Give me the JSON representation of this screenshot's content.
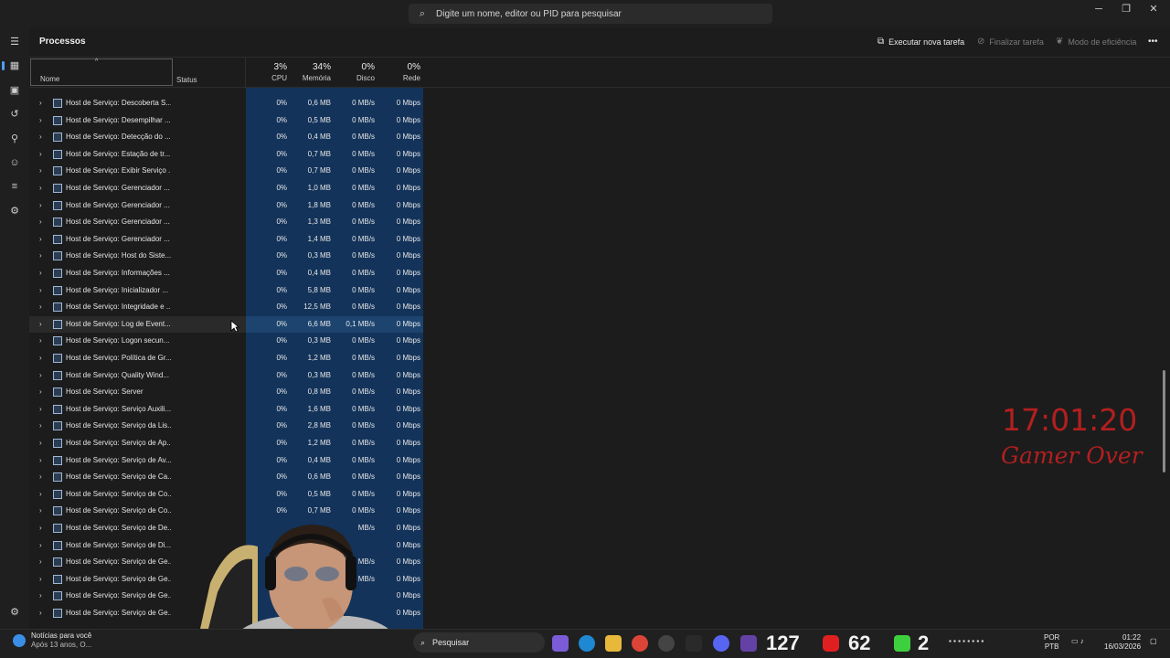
{
  "search": {
    "placeholder": "Digite um nome, editor ou PID para pesquisar"
  },
  "page_title": "Processos",
  "commands": {
    "run_task": "Executar nova tarefa",
    "end_task": "Finalizar tarefa",
    "efficiency": "Modo de eficiência"
  },
  "columns": {
    "name": "Nome",
    "status": "Status",
    "cpu": {
      "pct": "3%",
      "label": "CPU"
    },
    "memory": {
      "pct": "34%",
      "label": "Memória"
    },
    "disk": {
      "pct": "0%",
      "label": "Disco"
    },
    "network": {
      "pct": "0%",
      "label": "Rede"
    }
  },
  "rows": [
    {
      "name": "Host de Serviço: Descoberta S...",
      "cpu": "0%",
      "mem": "0,6 MB",
      "disk": "0 MB/s",
      "net": "0 Mbps"
    },
    {
      "name": "Host de Serviço: Desempilhar ...",
      "cpu": "0%",
      "mem": "0,5 MB",
      "disk": "0 MB/s",
      "net": "0 Mbps"
    },
    {
      "name": "Host de Serviço: Detecção do ...",
      "cpu": "0%",
      "mem": "0,4 MB",
      "disk": "0 MB/s",
      "net": "0 Mbps"
    },
    {
      "name": "Host de Serviço: Estação de tr...",
      "cpu": "0%",
      "mem": "0,7 MB",
      "disk": "0 MB/s",
      "net": "0 Mbps"
    },
    {
      "name": "Host de Serviço: Exibir Serviço ...",
      "cpu": "0%",
      "mem": "0,7 MB",
      "disk": "0 MB/s",
      "net": "0 Mbps"
    },
    {
      "name": "Host de Serviço: Gerenciador ...",
      "cpu": "0%",
      "mem": "1,0 MB",
      "disk": "0 MB/s",
      "net": "0 Mbps"
    },
    {
      "name": "Host de Serviço: Gerenciador ...",
      "cpu": "0%",
      "mem": "1,8 MB",
      "disk": "0 MB/s",
      "net": "0 Mbps"
    },
    {
      "name": "Host de Serviço: Gerenciador ...",
      "cpu": "0%",
      "mem": "1,3 MB",
      "disk": "0 MB/s",
      "net": "0 Mbps"
    },
    {
      "name": "Host de Serviço: Gerenciador ...",
      "cpu": "0%",
      "mem": "1,4 MB",
      "disk": "0 MB/s",
      "net": "0 Mbps"
    },
    {
      "name": "Host de Serviço: Host do Siste...",
      "cpu": "0%",
      "mem": "0,3 MB",
      "disk": "0 MB/s",
      "net": "0 Mbps"
    },
    {
      "name": "Host de Serviço: Informações ...",
      "cpu": "0%",
      "mem": "0,4 MB",
      "disk": "0 MB/s",
      "net": "0 Mbps"
    },
    {
      "name": "Host de Serviço: Inicializador ...",
      "cpu": "0%",
      "mem": "5,8 MB",
      "disk": "0 MB/s",
      "net": "0 Mbps"
    },
    {
      "name": "Host de Serviço: Integridade e ...",
      "cpu": "0%",
      "mem": "12,5 MB",
      "disk": "0 MB/s",
      "net": "0 Mbps"
    },
    {
      "name": "Host de Serviço: Log de Event...",
      "cpu": "0%",
      "mem": "6,6 MB",
      "disk": "0,1 MB/s",
      "net": "0 Mbps"
    },
    {
      "name": "Host de Serviço: Logon secun...",
      "cpu": "0%",
      "mem": "0,3 MB",
      "disk": "0 MB/s",
      "net": "0 Mbps"
    },
    {
      "name": "Host de Serviço: Política de Gr...",
      "cpu": "0%",
      "mem": "1,2 MB",
      "disk": "0 MB/s",
      "net": "0 Mbps"
    },
    {
      "name": "Host de Serviço: Quality Wind...",
      "cpu": "0%",
      "mem": "0,3 MB",
      "disk": "0 MB/s",
      "net": "0 Mbps"
    },
    {
      "name": "Host de Serviço: Server",
      "cpu": "0%",
      "mem": "0,8 MB",
      "disk": "0 MB/s",
      "net": "0 Mbps"
    },
    {
      "name": "Host de Serviço: Serviço Auxili...",
      "cpu": "0%",
      "mem": "1,6 MB",
      "disk": "0 MB/s",
      "net": "0 Mbps"
    },
    {
      "name": "Host de Serviço: Serviço da Lis...",
      "cpu": "0%",
      "mem": "2,8 MB",
      "disk": "0 MB/s",
      "net": "0 Mbps"
    },
    {
      "name": "Host de Serviço: Serviço de Ap...",
      "cpu": "0%",
      "mem": "1,2 MB",
      "disk": "0 MB/s",
      "net": "0 Mbps"
    },
    {
      "name": "Host de Serviço: Serviço de Av...",
      "cpu": "0%",
      "mem": "0,4 MB",
      "disk": "0 MB/s",
      "net": "0 Mbps"
    },
    {
      "name": "Host de Serviço: Serviço de Ca...",
      "cpu": "0%",
      "mem": "0,6 MB",
      "disk": "0 MB/s",
      "net": "0 Mbps"
    },
    {
      "name": "Host de Serviço: Serviço de Co...",
      "cpu": "0%",
      "mem": "0,5 MB",
      "disk": "0 MB/s",
      "net": "0 Mbps"
    },
    {
      "name": "Host de Serviço: Serviço de Co...",
      "cpu": "0%",
      "mem": "0,7 MB",
      "disk": "0 MB/s",
      "net": "0 Mbps"
    },
    {
      "name": "Host de Serviço: Serviço de De...",
      "cpu": "",
      "mem": "",
      "disk": "MB/s",
      "net": "0 Mbps"
    },
    {
      "name": "Host de Serviço: Serviço de Di...",
      "cpu": "",
      "mem": "",
      "disk": "",
      "net": "0 Mbps"
    },
    {
      "name": "Host de Serviço: Serviço de Ge...",
      "cpu": "",
      "mem": "",
      "disk": "MB/s",
      "net": "0 Mbps"
    },
    {
      "name": "Host de Serviço: Serviço de Ge...",
      "cpu": "",
      "mem": "",
      "disk": "MB/s",
      "net": "0 Mbps"
    },
    {
      "name": "Host de Serviço: Serviço de Ge...",
      "cpu": "",
      "mem": "",
      "disk": "",
      "net": "0 Mbps"
    },
    {
      "name": "Host de Serviço: Serviço de Ge...",
      "cpu": "",
      "mem": "",
      "disk": "",
      "net": "0 Mbps"
    }
  ],
  "highlighted_row": 13,
  "overlay": {
    "clock": "17:01:20",
    "caption": "Gamer Over"
  },
  "taskbar": {
    "news_title": "Notícias para você",
    "news_sub": "Após 13 anos, O...",
    "search_label": "Pesquisar",
    "counter_a": "127",
    "counter_b": "62",
    "counter_c": "2",
    "lang_1": "POR",
    "lang_2": "PTB",
    "time": "01:22",
    "date": "16/03/2026"
  },
  "colors": {
    "accent": "#4ca0ff",
    "band": "#13335a",
    "overlay_red": "#b31f1f"
  }
}
